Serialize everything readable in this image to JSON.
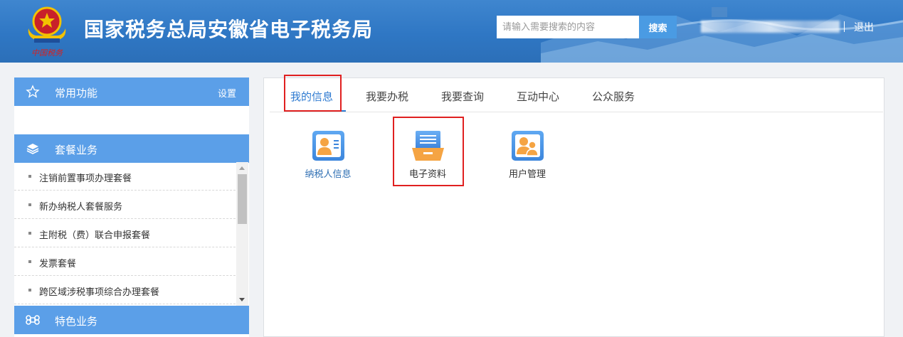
{
  "header": {
    "title": "国家税务总局安徽省电子税务局",
    "search_placeholder": "请输入需要搜索的内容",
    "search_button": "搜索",
    "logout": "退出",
    "emblem_caption": "中国税务"
  },
  "sidebar": {
    "favorites": {
      "label": "常用功能",
      "settings": "设置",
      "icon": "star-icon"
    },
    "packages": {
      "label": "套餐业务",
      "icon": "layers-icon",
      "items": [
        {
          "label": "注销前置事项办理套餐"
        },
        {
          "label": "新办纳税人套餐服务"
        },
        {
          "label": "主附税（费）联合申报套餐"
        },
        {
          "label": "发票套餐"
        },
        {
          "label": "跨区域涉税事项综合办理套餐"
        }
      ]
    },
    "special": {
      "label": "特色业务",
      "icon": "command-icon"
    }
  },
  "main": {
    "tabs": [
      {
        "label": "我的信息",
        "active": true
      },
      {
        "label": "我要办税"
      },
      {
        "label": "我要查询"
      },
      {
        "label": "互动中心"
      },
      {
        "label": "公众服务"
      }
    ],
    "tiles": [
      {
        "label": "纳税人信息",
        "icon": "id-card-icon"
      },
      {
        "label": "电子资料",
        "icon": "document-tray-icon"
      },
      {
        "label": "用户管理",
        "icon": "users-icon"
      }
    ]
  },
  "colors": {
    "header_blue": "#2f77c4",
    "sidebar_header": "#5b9fe8",
    "accent": "#2f7bd1",
    "highlight_red": "#e02020"
  }
}
